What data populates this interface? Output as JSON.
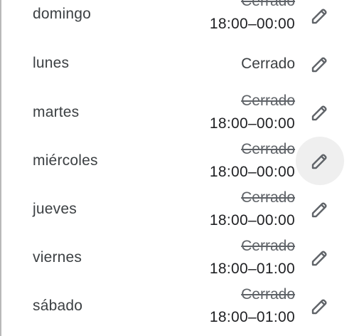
{
  "schedule": [
    {
      "day": "domingo",
      "old": "Cerrado",
      "new": "18:00–00:00"
    },
    {
      "day": "lunes",
      "status": "Cerrado"
    },
    {
      "day": "martes",
      "old": "Cerrado",
      "new": "18:00–00:00"
    },
    {
      "day": "miércoles",
      "old": "Cerrado",
      "new": "18:00–00:00"
    },
    {
      "day": "jueves",
      "old": "Cerrado",
      "new": "18:00–00:00"
    },
    {
      "day": "viernes",
      "old": "Cerrado",
      "new": "18:00–01:00"
    },
    {
      "day": "sábado",
      "old": "Cerrado",
      "new": "18:00–01:00"
    }
  ],
  "icons": {
    "edit": "pencil-icon"
  },
  "colors": {
    "text": "#3c4043",
    "hover_bg": "#efefef"
  }
}
